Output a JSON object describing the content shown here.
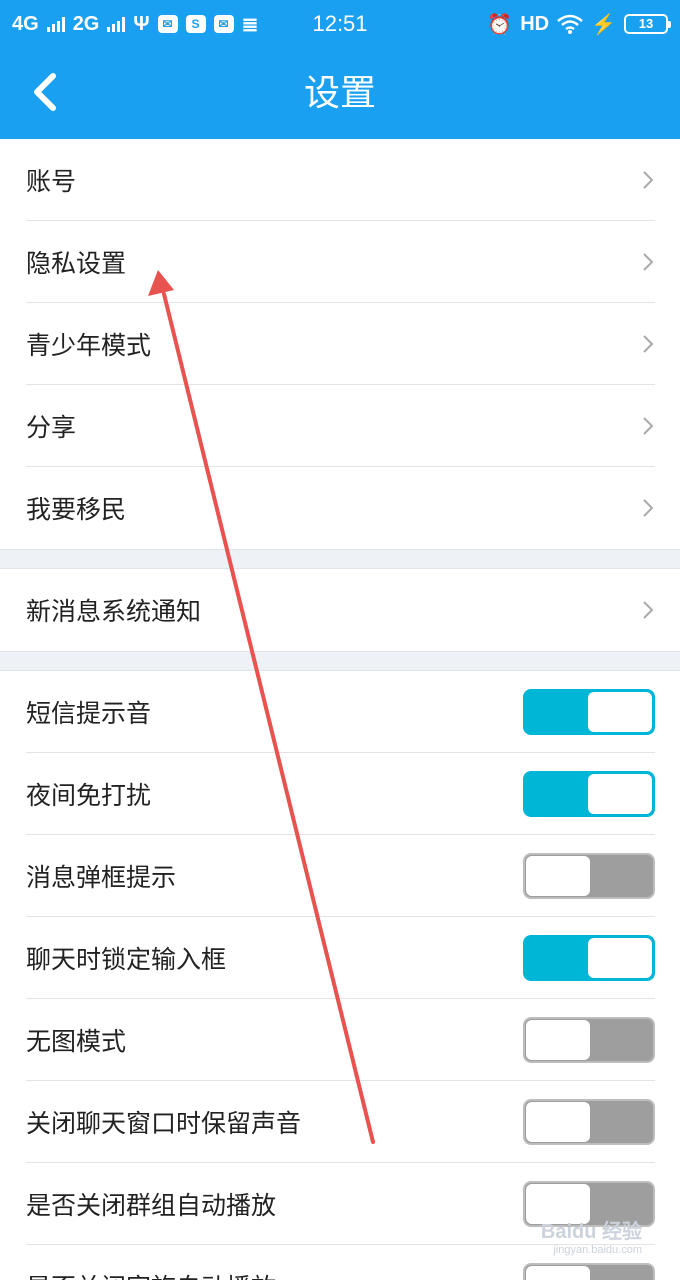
{
  "status_bar": {
    "network1": "4G",
    "network2": "2G",
    "time": "12:51",
    "hd": "HD",
    "battery": "13"
  },
  "header": {
    "title": "设置"
  },
  "groups": [
    {
      "items": [
        {
          "label": "账号",
          "type": "link"
        },
        {
          "label": "隐私设置",
          "type": "link"
        },
        {
          "label": "青少年模式",
          "type": "link"
        },
        {
          "label": "分享",
          "type": "link"
        },
        {
          "label": "我要移民",
          "type": "link"
        }
      ]
    },
    {
      "items": [
        {
          "label": "新消息系统通知",
          "type": "link"
        }
      ]
    },
    {
      "items": [
        {
          "label": "短信提示音",
          "type": "toggle",
          "on": true
        },
        {
          "label": "夜间免打扰",
          "type": "toggle",
          "on": true
        },
        {
          "label": "消息弹框提示",
          "type": "toggle",
          "on": false
        },
        {
          "label": "聊天时锁定输入框",
          "type": "toggle",
          "on": true
        },
        {
          "label": "无图模式",
          "type": "toggle",
          "on": false
        },
        {
          "label": "关闭聊天窗口时保留声音",
          "type": "toggle",
          "on": false
        },
        {
          "label": "是否关闭群组自动播放",
          "type": "toggle",
          "on": false
        },
        {
          "label": "是否关闭家族自动播放",
          "type": "toggle",
          "on": false
        }
      ]
    }
  ],
  "colors": {
    "header_bg": "#1aa0f0",
    "toggle_on": "#00b6d6",
    "toggle_off": "#9e9e9e",
    "annotation_arrow": "#e8524f"
  },
  "watermark": {
    "text": "Baidu 经验",
    "sub": "jingyan.baidu.com"
  }
}
